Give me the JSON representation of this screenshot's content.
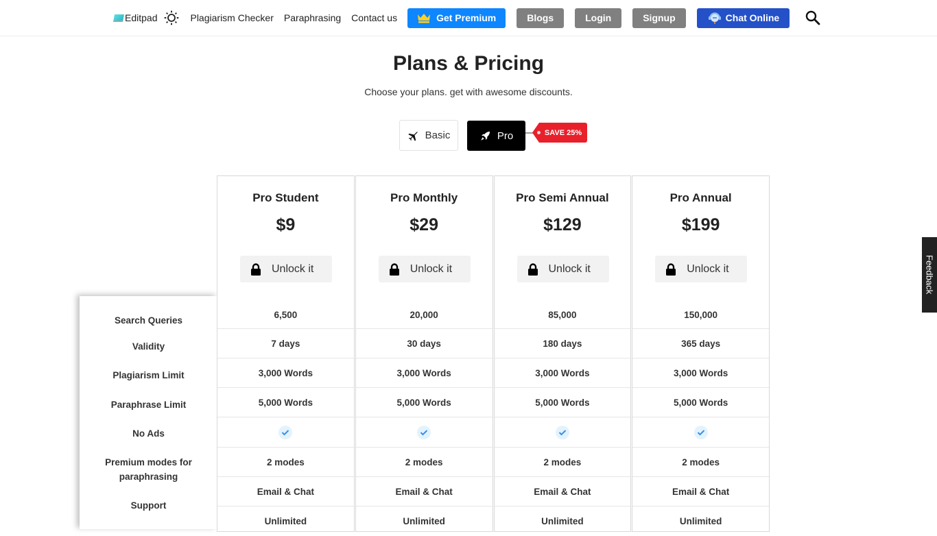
{
  "nav": {
    "brand": "Editpad",
    "links": [
      "Plagiarism Checker",
      "Paraphrasing",
      "Contact us"
    ],
    "get_premium": "Get Premium",
    "blogs": "Blogs",
    "login": "Login",
    "signup": "Signup",
    "chat_online": "Chat Online"
  },
  "colors": {
    "premium": "#0d86ff",
    "grey_button": "#808080",
    "chat": "#2451c8",
    "save_tag": "#e8202b"
  },
  "page": {
    "title": "Plans & Pricing",
    "subtitle": "Choose your plans. get with awesome discounts."
  },
  "toggle": {
    "basic": "Basic",
    "pro": "Pro",
    "selected": "Pro",
    "save_badge": "SAVE 25%"
  },
  "features": [
    "Search Queries",
    "Validity",
    "Plagiarism Limit",
    "Paraphrase Limit",
    "No Ads",
    "Premium modes for paraphrasing",
    "Support"
  ],
  "unlock_label": "Unlock it",
  "plans": [
    {
      "name": "Pro Student",
      "price": "$9",
      "values": [
        "6,500",
        "7 days",
        "3,000 Words",
        "5,000 Words",
        "check",
        "2 modes",
        "Email & Chat",
        "Unlimited"
      ]
    },
    {
      "name": "Pro Monthly",
      "price": "$29",
      "values": [
        "20,000",
        "30 days",
        "3,000 Words",
        "5,000 Words",
        "check",
        "2 modes",
        "Email & Chat",
        "Unlimited"
      ]
    },
    {
      "name": "Pro Semi Annual",
      "price": "$129",
      "values": [
        "85,000",
        "180 days",
        "3,000 Words",
        "5,000 Words",
        "check",
        "2 modes",
        "Email & Chat",
        "Unlimited"
      ]
    },
    {
      "name": "Pro Annual",
      "price": "$199",
      "values": [
        "150,000",
        "365 days",
        "3,000 Words",
        "5,000 Words",
        "check",
        "2 modes",
        "Email & Chat",
        "Unlimited"
      ]
    }
  ],
  "feedback": "Feedback"
}
